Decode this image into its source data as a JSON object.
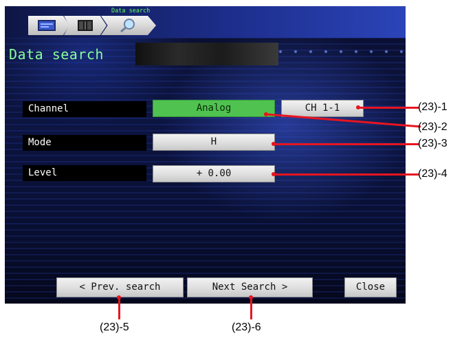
{
  "breadcrumb": {
    "caption": "Data search",
    "items": [
      {
        "icon": "monitor-icon"
      },
      {
        "icon": "table-icon"
      },
      {
        "icon": "magnifier-icon"
      }
    ]
  },
  "page_title": "Data search",
  "form": {
    "channel": {
      "label": "Channel",
      "type_value": "Analog",
      "channel_value": "CH 1-1"
    },
    "mode": {
      "label": "Mode",
      "value": "H"
    },
    "level": {
      "label": "Level",
      "value": "+ 0.00"
    }
  },
  "buttons": {
    "prev": "< Prev. search",
    "next": "Next Search >",
    "close": "Close"
  },
  "callouts": {
    "c1": "(23)-1",
    "c2": "(23)-2",
    "c3": "(23)-3",
    "c4": "(23)-4",
    "c5": "(23)-5",
    "c6": "(23)-6"
  },
  "colors": {
    "highlight": "#4fc24f",
    "title_text": "#88ff99",
    "callout": "#e8141f"
  }
}
